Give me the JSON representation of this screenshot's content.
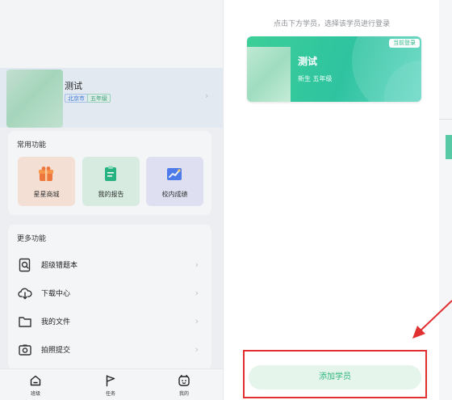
{
  "profile": {
    "name": "测试",
    "city_tag": "北京市",
    "grade_tag": "五年级"
  },
  "common": {
    "title": "常用功能",
    "items": [
      {
        "label": "星星商城",
        "icon": "gift-box-icon"
      },
      {
        "label": "我的报告",
        "icon": "report-icon"
      },
      {
        "label": "校内成绩",
        "icon": "trend-chart-icon"
      }
    ]
  },
  "more": {
    "title": "更多功能",
    "items": [
      {
        "label": "超级错题本",
        "icon": "search-notebook-icon"
      },
      {
        "label": "下载中心",
        "icon": "cloud-download-icon"
      },
      {
        "label": "我的文件",
        "icon": "folder-icon"
      },
      {
        "label": "拍照提交",
        "icon": "camera-icon"
      }
    ]
  },
  "tabbar": {
    "items": [
      {
        "label": "班级",
        "icon": "house-icon"
      },
      {
        "label": "任务",
        "icon": "flag-icon"
      },
      {
        "label": "我的",
        "icon": "face-icon"
      }
    ]
  },
  "switcher": {
    "hint": "点击下方学员，选择该学员进行登录",
    "student": {
      "name": "测试",
      "subtitle": "新生 五年级",
      "badge": "当前登录"
    },
    "add_button": "添加学员"
  },
  "colors": {
    "accent_green": "#2fc3a0",
    "annotation_red": "#e03030"
  }
}
